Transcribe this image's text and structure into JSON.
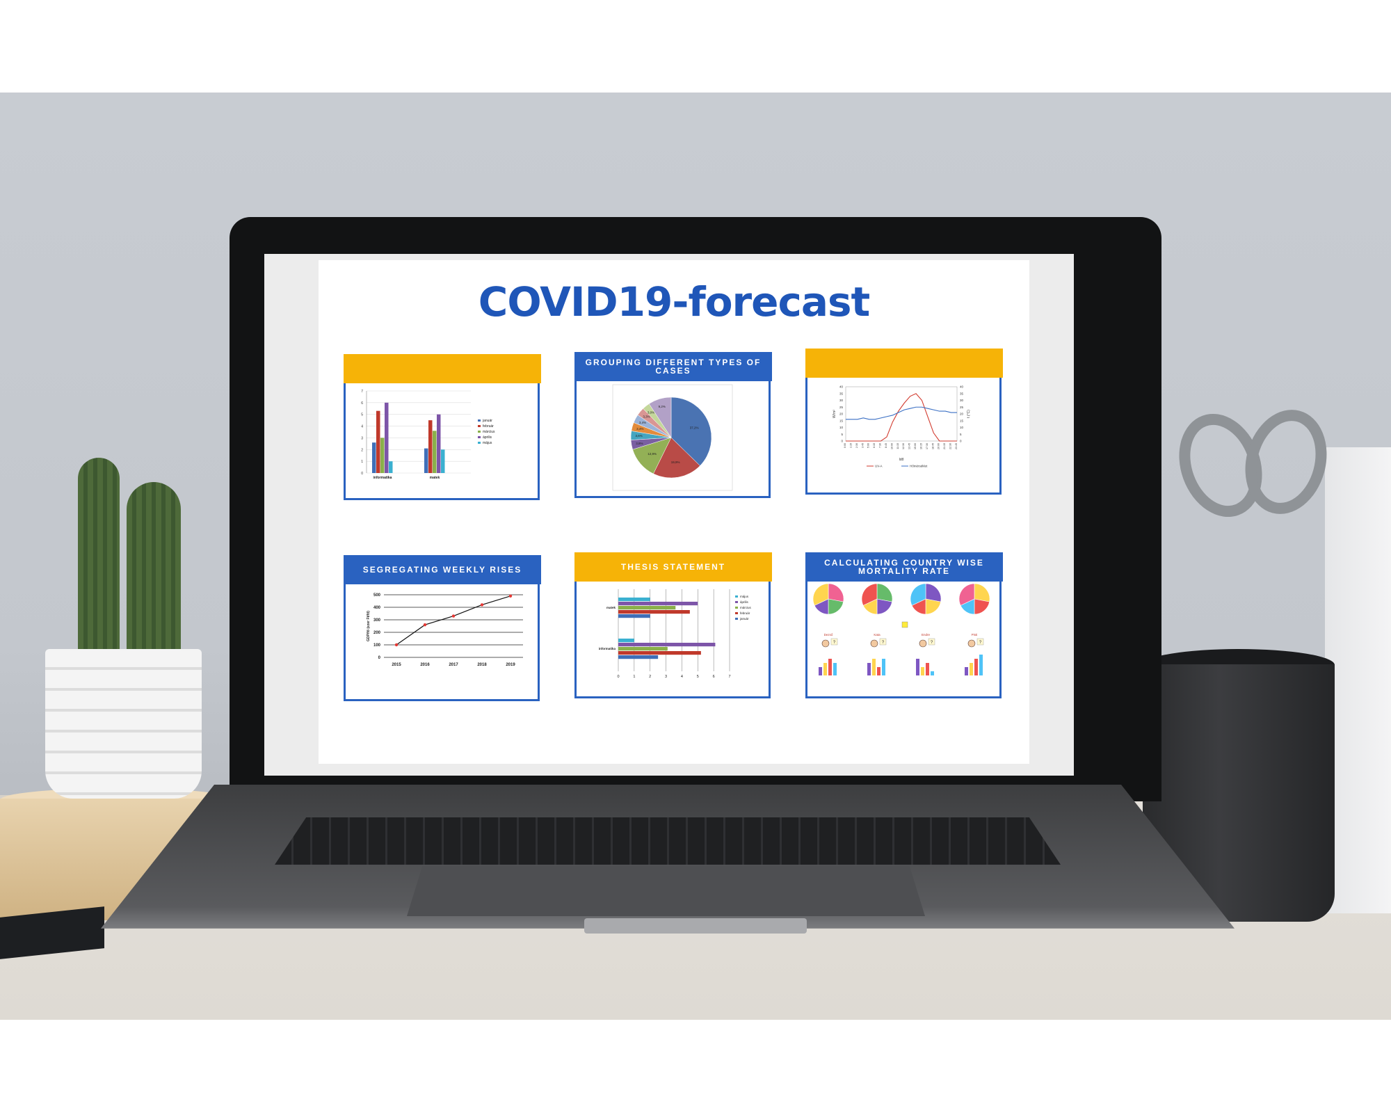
{
  "slide": {
    "title": "COVID19-forecast"
  },
  "cards": [
    {
      "heading": "",
      "head_color": "#f6b307"
    },
    {
      "heading": "GROUPING DIFFERENT TYPES OF CASES",
      "head_color": "#2a62c0"
    },
    {
      "heading": "",
      "head_color": "#f6b307"
    },
    {
      "heading": "SEGREGATING WEEKLY RISES",
      "head_color": "#2a62c0"
    },
    {
      "heading": "THESIS STATEMENT",
      "head_color": "#f6b307"
    },
    {
      "heading": "CALCULATING COUNTRY WISE MORTALITY RATE",
      "head_color": "#2a62c0"
    }
  ],
  "chart_data": [
    {
      "type": "bar",
      "categories": [
        "informatika",
        "matek"
      ],
      "series": [
        {
          "name": "január",
          "values": [
            2.6,
            2.1
          ],
          "color": "#3f6fb8"
        },
        {
          "name": "február",
          "values": [
            5.3,
            4.5
          ],
          "color": "#c0392b"
        },
        {
          "name": "március",
          "values": [
            3.0,
            3.6
          ],
          "color": "#8ab04a"
        },
        {
          "name": "április",
          "values": [
            6.0,
            5.0
          ],
          "color": "#7d55a8"
        },
        {
          "name": "május",
          "values": [
            1.0,
            2.0
          ],
          "color": "#3ab0d0"
        }
      ],
      "ylim": [
        0,
        7
      ],
      "yticks": [
        "0",
        "1",
        "2",
        "3",
        "4",
        "5",
        "6",
        "7"
      ]
    },
    {
      "type": "pie",
      "slices": [
        {
          "value": 37.2,
          "label": "37,2%",
          "color": "#4a73b2"
        },
        {
          "value": 19.9,
          "label": "19,9%",
          "color": "#b94b47"
        },
        {
          "value": 12.9,
          "label": "12,9%",
          "color": "#93b056"
        },
        {
          "value": 3.8,
          "label": "3,8%",
          "color": "#7a5fa2"
        },
        {
          "value": 3.6,
          "label": "3,6%",
          "color": "#45a5c0"
        },
        {
          "value": 3.4,
          "label": "3,4%",
          "color": "#e28b3b"
        },
        {
          "value": 3.4,
          "label": "3,4%",
          "color": "#9bb3d8"
        },
        {
          "value": 3.3,
          "label": "3,3%",
          "color": "#d99694"
        },
        {
          "value": 3.0,
          "label": "3,0%",
          "color": "#c4d79b"
        },
        {
          "value": 9.2,
          "label": "9,2%",
          "color": "#b2a1c7"
        }
      ]
    },
    {
      "type": "line",
      "x": [
        "0:00",
        "1:15",
        "2:30",
        "3:45",
        "5:00",
        "6:15",
        "7:30",
        "8:45",
        "10:00",
        "11:15",
        "12:30",
        "13:45",
        "15:00",
        "16:15",
        "17:30",
        "18:45",
        "20:00",
        "21:15",
        "22:30",
        "23:45"
      ],
      "series": [
        {
          "name": "UV-A",
          "color": "#d23a2e",
          "values": [
            0,
            0,
            0,
            0,
            0,
            0,
            0,
            3,
            14,
            22,
            28,
            33,
            35,
            30,
            18,
            6,
            0,
            0,
            0,
            0
          ]
        },
        {
          "name": "Hőmérséklet",
          "color": "#3a6fc4",
          "values": [
            16,
            16,
            16,
            17,
            16,
            16,
            17,
            18,
            19,
            21,
            23,
            24,
            25,
            25,
            24,
            23,
            22,
            22,
            21,
            21
          ]
        }
      ],
      "ylim": [
        0,
        40
      ],
      "yticks": [
        "0",
        "5",
        "10",
        "15",
        "20",
        "25",
        "30",
        "35",
        "40"
      ],
      "xlabel": "Idő",
      "ylabel": "W/m²",
      "y2label": "t (°C)"
    },
    {
      "type": "line",
      "x": [
        "2015",
        "2016",
        "2017",
        "2018",
        "2019"
      ],
      "values": [
        100,
        260,
        330,
        420,
        490
      ],
      "ylim": [
        0,
        500
      ],
      "yticks": [
        "0",
        "100",
        "200",
        "300",
        "400",
        "500"
      ],
      "ylabel": "GDP/fő (ezer Ft/fő)"
    },
    {
      "type": "bar",
      "orientation": "horizontal",
      "categories": [
        "matek",
        "informatika"
      ],
      "series": [
        {
          "name": "január",
          "values": [
            2.0,
            2.5
          ],
          "color": "#3f6fb8"
        },
        {
          "name": "február",
          "values": [
            4.5,
            5.2
          ],
          "color": "#c0392b"
        },
        {
          "name": "március",
          "values": [
            3.6,
            3.1
          ],
          "color": "#8ab04a"
        },
        {
          "name": "április",
          "values": [
            5.0,
            6.1
          ],
          "color": "#7d55a8"
        },
        {
          "name": "május",
          "values": [
            2.0,
            1.0
          ],
          "color": "#3ab0d0"
        }
      ],
      "legend": [
        "május",
        "április",
        "március",
        "február",
        "január"
      ],
      "xlim": [
        0,
        7
      ],
      "xticks": [
        "0",
        "1",
        "2",
        "3",
        "4",
        "5",
        "6",
        "7"
      ]
    },
    {
      "type": "pie",
      "small_multiples": 4,
      "labels": [
        "Dezső",
        "Kata",
        "Endre",
        "Pisti"
      ],
      "bar_values": [
        [
          2,
          3,
          4,
          3
        ],
        [
          3,
          4,
          2,
          4
        ],
        [
          4,
          2,
          3,
          1
        ],
        [
          2,
          3,
          4,
          5
        ]
      ],
      "badge": "?"
    }
  ]
}
